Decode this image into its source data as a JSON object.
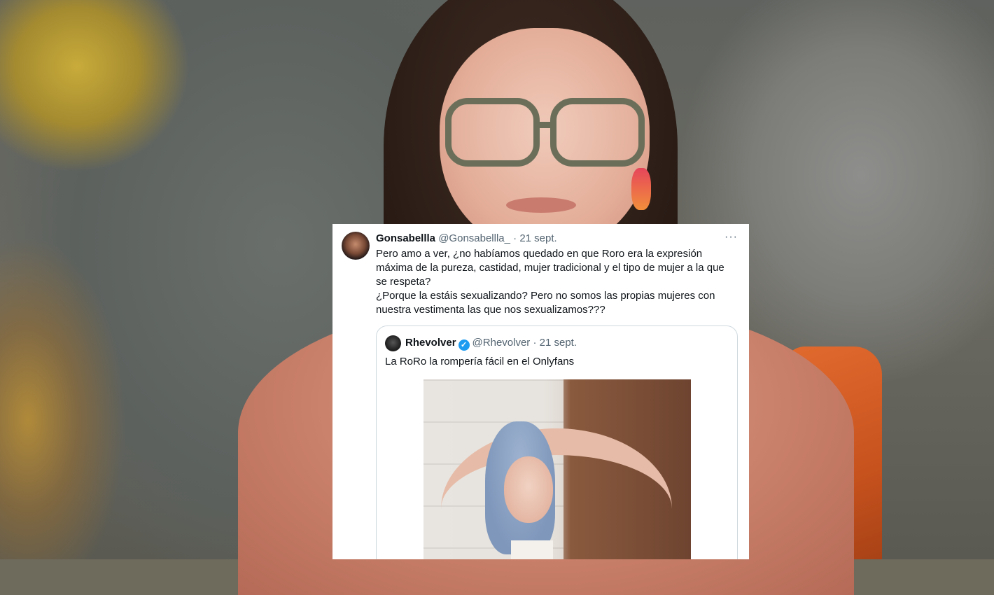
{
  "tweet": {
    "author_name": "Gonsabellla",
    "author_handle": "@Gonsabellla_",
    "date": "· 21 sept.",
    "more_icon": "···",
    "lines": [
      "Pero amo a ver, ¿no habíamos quedado en que Roro era la expresión",
      "máxima de la pureza, castidad, mujer tradicional y el tipo de mujer a la que",
      "se respeta?",
      "¿Porque la estáis sexualizando? Pero no somos las propias mujeres con",
      "nuestra vestimenta las que nos sexualizamos???"
    ]
  },
  "quoted": {
    "author_name": "Rhevolver",
    "verified_icon": "✓",
    "author_handle": "@Rhevolver",
    "date": "· 21 sept.",
    "text": "La RoRo la rompería fácil en el Onlyfans"
  },
  "colors": {
    "verified": "#1d9bf0",
    "text_primary": "#0f1419",
    "text_secondary": "#536471",
    "border": "#cfd9de"
  }
}
